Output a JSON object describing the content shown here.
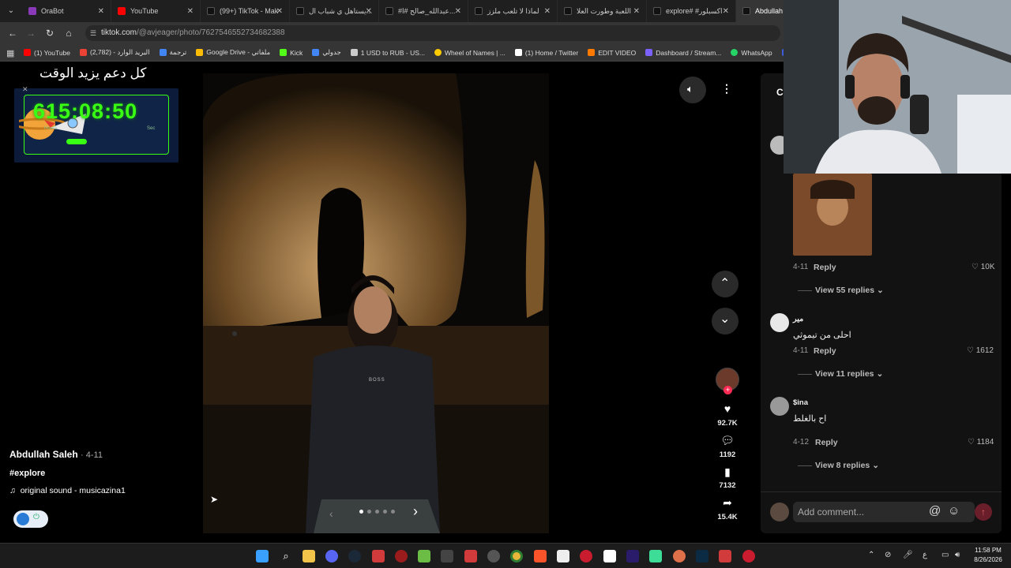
{
  "browser": {
    "tabs": [
      {
        "label": "OraBot",
        "color": "#8a3ab9"
      },
      {
        "label": "YouTube",
        "color": "#ff0000"
      },
      {
        "label": "(99+) TikTok - Mak",
        "color": "#111111"
      },
      {
        "label": "يستاهل ي شباب ال...",
        "color": "#111111"
      },
      {
        "label": "#عبدالله_صالح #ا...",
        "color": "#111111"
      },
      {
        "label": "لماذا لا تلعب ملزز",
        "color": "#111111"
      },
      {
        "label": "اللعبة وطورت العلا",
        "color": "#111111"
      },
      {
        "label": "explore# #اكسبلور",
        "color": "#111111"
      },
      {
        "label": "Abdullah S",
        "color": "#111111"
      }
    ],
    "url_domain": "tiktok.com",
    "url_path": "/@avjeager/photo/7627546552734682388",
    "bookmarks": [
      {
        "label": "(1) YouTube",
        "color": "#ff0000"
      },
      {
        "label": "(2,782) - البريد الوارد",
        "color": "#ea4335"
      },
      {
        "label": "ترجمة",
        "color": "#4285f4"
      },
      {
        "label": "Google Drive - ملفاتي",
        "color": "#fbbc05"
      },
      {
        "label": "Kick",
        "color": "#53fc18"
      },
      {
        "label": "جدولي",
        "color": "#4285f4"
      },
      {
        "label": "1 USD to RUB - US...",
        "color": "#cccccc"
      },
      {
        "label": "Wheel of Names | ...",
        "color": "#ffcc00"
      },
      {
        "label": "(1) Home / Twitter",
        "color": "#ffffff"
      },
      {
        "label": "EDIT VIDEO",
        "color": "#ff7a00"
      },
      {
        "label": "Dashboard / Stream...",
        "color": "#7b61ff"
      },
      {
        "label": "WhatsApp",
        "color": "#25d366"
      },
      {
        "label": "D",
        "color": "#3b5bdb"
      }
    ]
  },
  "overlay": {
    "banner_text": "كل دعم يزيد الوقت",
    "timer": "615:08:50",
    "small_label_1": "Hours",
    "small_label_2": "Sec"
  },
  "post": {
    "author": "Abdullah Saleh",
    "date": "· 4-11",
    "hashtag": "#explore",
    "sound": "original sound - musicazina1",
    "likes": "92.7K",
    "comments": "1192",
    "saves": "7132",
    "shares": "15.4K",
    "photo_dots": 5,
    "shirt_text": "BOSS"
  },
  "comments": {
    "header_initial": "C",
    "items": [
      {
        "name": "",
        "text": "",
        "time": "4-11",
        "reply": "Reply",
        "likes": "10K",
        "views": "View 55 replies"
      },
      {
        "name": "مير",
        "text": "احلى من تيموثي",
        "time": "4-11",
        "reply": "Reply",
        "likes": "1612",
        "views": "View 11 replies"
      },
      {
        "name": "$ina",
        "text": "اح بالغلط",
        "time": "4-12",
        "reply": "Reply",
        "likes": "1184",
        "views": "View 8 replies"
      }
    ],
    "add_placeholder": "Add comment..."
  },
  "taskbar": {
    "time": "11:58 PM",
    "date": "8/26/2026",
    "lang": "ع"
  },
  "colors": {
    "accent": "#fe2c55",
    "timer_green": "#39ff14"
  }
}
